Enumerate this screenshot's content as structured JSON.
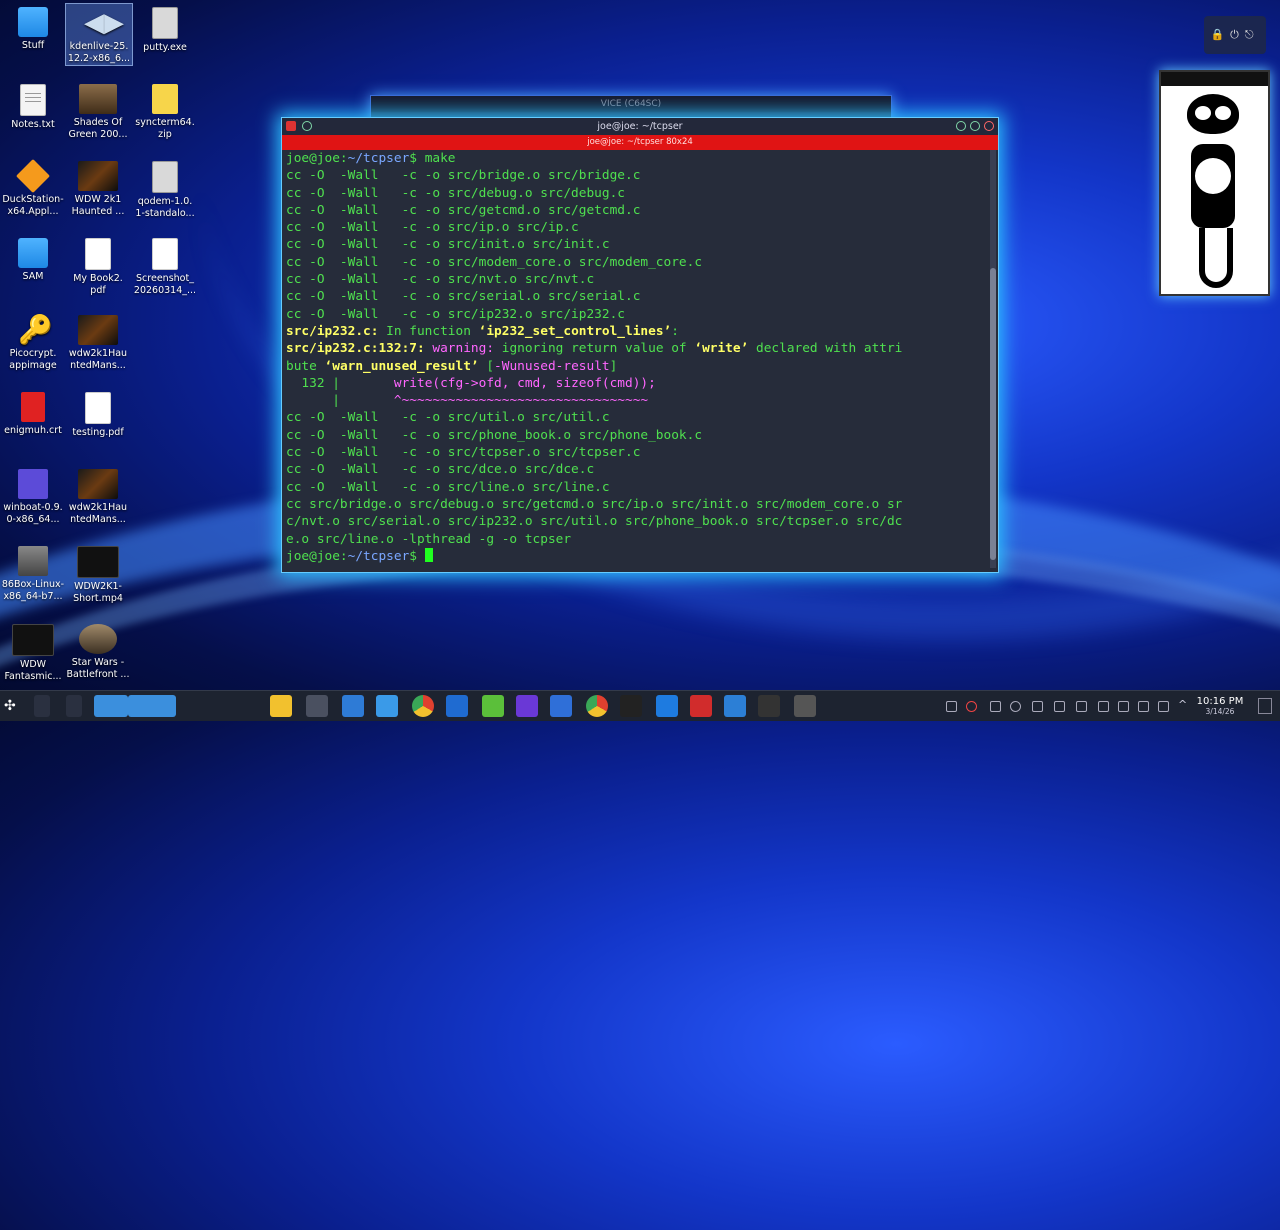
{
  "desktop_icons": [
    {
      "name": "stuff",
      "label": "Stuff",
      "type": "folder"
    },
    {
      "name": "kdenlive",
      "label": "kdenlive-25.\n12.2-x86_6...",
      "type": "kden",
      "selected": true
    },
    {
      "name": "putty",
      "label": "putty.exe",
      "type": "exe"
    },
    {
      "name": "notes",
      "label": "Notes.txt",
      "type": "doc"
    },
    {
      "name": "shades-of-green",
      "label": "Shades Of\nGreen 200...",
      "type": "photo"
    },
    {
      "name": "syncterm",
      "label": "syncterm64.\nzip",
      "type": "zip"
    },
    {
      "name": "duckstation",
      "label": "DuckStation-\nx64.Appl...",
      "type": "duck"
    },
    {
      "name": "wdw-2k1-haunted",
      "label": "WDW 2k1\nHaunted ...",
      "type": "vid"
    },
    {
      "name": "qodem",
      "label": "qodem-1.0.\n1-standalo...",
      "type": "exe"
    },
    {
      "name": "sam",
      "label": "SAM",
      "type": "folder"
    },
    {
      "name": "my-book2",
      "label": "My Book2.\npdf",
      "type": "pdf"
    },
    {
      "name": "screenshot",
      "label": "Screenshot_\n20260314_...",
      "type": "pdf"
    },
    {
      "name": "picocrypt",
      "label": "Picocrypt.\nappimage",
      "type": "key"
    },
    {
      "name": "wdw2k1-haunted-mans-1",
      "label": "wdw2k1Hau\nntedMans...",
      "type": "vid"
    },
    {
      "name": "enigmuh",
      "label": "enigmuh.crt",
      "type": "red"
    },
    {
      "name": "testing-pdf",
      "label": "testing.pdf",
      "type": "pdf"
    },
    {
      "name": "winboat",
      "label": "winboat-0.9.\n0-x86_64...",
      "type": "purple"
    },
    {
      "name": "wdw2k1-haunted-mans-2",
      "label": "wdw2k1Hau\nntedMans...",
      "type": "vid"
    },
    {
      "name": "86box",
      "label": "86Box-Linux-\nx86_64-b7...",
      "type": "box86"
    },
    {
      "name": "wdw2k1-short",
      "label": "WDW2K1-\nShort.mp4",
      "type": "dark"
    },
    {
      "name": "wdw-fantasmic",
      "label": "WDW\nFantasmic...",
      "type": "dark"
    },
    {
      "name": "star-wars-battlefront",
      "label": "Star Wars -\nBattlefront ...",
      "type": "sw"
    }
  ],
  "vice_window": {
    "title": "VICE (C64SC)"
  },
  "terminal": {
    "title": "joe@joe: ~/tcpser",
    "subtitle": "joe@joe: ~/tcpser 80x24",
    "lines": [
      [
        {
          "c": "g",
          "t": "joe@joe:"
        },
        {
          "c": "bb",
          "t": "~/tcpser"
        },
        {
          "c": "g",
          "t": "$ make"
        }
      ],
      [
        {
          "c": "g",
          "t": "cc -O  -Wall   -c -o src/bridge.o src/bridge.c"
        }
      ],
      [
        {
          "c": "g",
          "t": "cc -O  -Wall   -c -o src/debug.o src/debug.c"
        }
      ],
      [
        {
          "c": "g",
          "t": "cc -O  -Wall   -c -o src/getcmd.o src/getcmd.c"
        }
      ],
      [
        {
          "c": "g",
          "t": "cc -O  -Wall   -c -o src/ip.o src/ip.c"
        }
      ],
      [
        {
          "c": "g",
          "t": "cc -O  -Wall   -c -o src/init.o src/init.c"
        }
      ],
      [
        {
          "c": "g",
          "t": "cc -O  -Wall   -c -o src/modem_core.o src/modem_core.c"
        }
      ],
      [
        {
          "c": "g",
          "t": "cc -O  -Wall   -c -o src/nvt.o src/nvt.c"
        }
      ],
      [
        {
          "c": "g",
          "t": "cc -O  -Wall   -c -o src/serial.o src/serial.c"
        }
      ],
      [
        {
          "c": "g",
          "t": "cc -O  -Wall   -c -o src/ip232.o src/ip232.c"
        }
      ],
      [
        {
          "c": "yb",
          "t": "src/ip232.c:"
        },
        {
          "c": "g",
          "t": " In function "
        },
        {
          "c": "yb",
          "t": "‘ip232_set_control_lines’"
        },
        {
          "c": "g",
          "t": ":"
        }
      ],
      [
        {
          "c": "yb",
          "t": "src/ip232.c:132:7:"
        },
        {
          "c": "mg",
          "t": " warning: "
        },
        {
          "c": "g",
          "t": "ignoring return value of "
        },
        {
          "c": "yb",
          "t": "‘write’"
        },
        {
          "c": "g",
          "t": " declared with attri"
        }
      ],
      [
        {
          "c": "g",
          "t": "bute "
        },
        {
          "c": "yb",
          "t": "‘warn_unused_result’"
        },
        {
          "c": "g",
          "t": " ["
        },
        {
          "c": "mg",
          "t": "-Wunused-result"
        },
        {
          "c": "g",
          "t": "]"
        }
      ],
      [
        {
          "c": "g",
          "t": "  132 |       "
        },
        {
          "c": "mg",
          "t": "write(cfg->ofd, cmd, sizeof(cmd));"
        }
      ],
      [
        {
          "c": "g",
          "t": "      |       "
        },
        {
          "c": "mg",
          "t": "^~~~~~~~~~~~~~~~~~~~~~~~~~~~~~~~~"
        }
      ],
      [
        {
          "c": "g",
          "t": "cc -O  -Wall   -c -o src/util.o src/util.c"
        }
      ],
      [
        {
          "c": "g",
          "t": "cc -O  -Wall   -c -o src/phone_book.o src/phone_book.c"
        }
      ],
      [
        {
          "c": "g",
          "t": "cc -O  -Wall   -c -o src/tcpser.o src/tcpser.c"
        }
      ],
      [
        {
          "c": "g",
          "t": "cc -O  -Wall   -c -o src/dce.o src/dce.c"
        }
      ],
      [
        {
          "c": "g",
          "t": "cc -O  -Wall   -c -o src/line.o src/line.c"
        }
      ],
      [
        {
          "c": "g",
          "t": "cc src/bridge.o src/debug.o src/getcmd.o src/ip.o src/init.o src/modem_core.o sr"
        }
      ],
      [
        {
          "c": "g",
          "t": "c/nvt.o src/serial.o src/ip232.o src/util.o src/phone_book.o src/tcpser.o src/dc"
        }
      ],
      [
        {
          "c": "g",
          "t": "e.o src/line.o -lpthread -g -o tcpser"
        }
      ],
      [
        {
          "c": "g",
          "t": "joe@joe:"
        },
        {
          "c": "bb",
          "t": "~/tcpser"
        },
        {
          "c": "g",
          "t": "$ "
        }
      ]
    ]
  },
  "taskbar": {
    "time": "10:16 PM",
    "date": "3/14/26",
    "apps": [
      "start-menu",
      "desktop-switch-1",
      "desktop-switch-2",
      "active-window",
      "active-window-2",
      "android-file",
      "settings",
      "file-manager",
      "files",
      "chrome",
      "word-doc",
      "editor",
      "obs-purple",
      "network-tool",
      "chrome-2",
      "cat-clock",
      "tool-d",
      "app-red",
      "bluetooth",
      "c64",
      "obs"
    ]
  },
  "colors": {
    "accent": "#2ec2ff",
    "terminal_bg": "#262c3a",
    "prompt_green": "#4fe04f",
    "warning_magenta": "#ff66ff",
    "title_red": "#e01414"
  }
}
